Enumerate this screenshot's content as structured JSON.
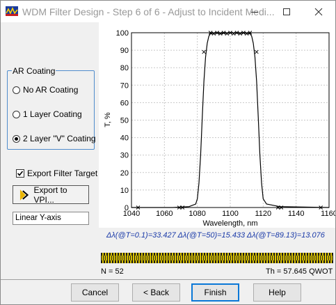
{
  "window": {
    "title": "WDM Filter Design - Step 6 of 6 - Adjust to Incident Medi..."
  },
  "ar_coating": {
    "legend": "AR Coating",
    "options": [
      {
        "label": "No AR Coating",
        "checked": false
      },
      {
        "label": "1 Layer Coating",
        "checked": false
      },
      {
        "label": "2 Layer \"V\" Coating",
        "checked": true
      }
    ]
  },
  "export_target": {
    "label": "Export Filter Target",
    "checked": true
  },
  "export_button": {
    "label": "Export to VPI..."
  },
  "yaxis_mode": {
    "value": "Linear Y-axis"
  },
  "chart_data": {
    "type": "line",
    "xlabel": "Wavelength, nm",
    "ylabel": "T, %",
    "xlim": [
      1040,
      1160
    ],
    "ylim": [
      0,
      100
    ],
    "xticks": [
      1040,
      1060,
      1080,
      1100,
      1120,
      1140,
      1160
    ],
    "yticks": [
      0,
      10,
      20,
      30,
      40,
      50,
      60,
      70,
      80,
      90,
      100
    ],
    "grid": true,
    "series": [
      {
        "x": [
          1040,
          1065,
          1075,
          1079,
          1080,
          1081,
          1082,
          1083,
          1084,
          1085,
          1086,
          1087,
          1088,
          1090,
          1095,
          1100,
          1105,
          1110,
          1112,
          1113,
          1114,
          1115,
          1116,
          1117,
          1118,
          1119,
          1120,
          1122,
          1130,
          1160
        ],
        "values": [
          0,
          0,
          0.5,
          2,
          5,
          14,
          30,
          52,
          72,
          86,
          94,
          98,
          99.5,
          99.8,
          99.6,
          99.9,
          99.7,
          99.8,
          99.5,
          98,
          94,
          86,
          72,
          52,
          30,
          14,
          5,
          2,
          0.5,
          0
        ]
      }
    ],
    "target_markers": {
      "x": [
        1044,
        1069,
        1071,
        1084,
        1088,
        1090,
        1092,
        1094,
        1096,
        1098,
        1100,
        1102,
        1104,
        1106,
        1108,
        1110,
        1112,
        1116,
        1129,
        1131,
        1155
      ],
      "values": [
        0,
        0,
        0,
        89,
        100,
        99.5,
        100,
        99.5,
        100,
        99.5,
        100,
        99.5,
        100,
        99.5,
        100,
        99.5,
        100,
        89,
        0,
        0,
        0
      ]
    }
  },
  "bandwidth_text": "Δλ(@T=0.1)=33.427  Δλ(@T=50)=15.433  Δλ(@T=89.13)=13.076",
  "n_label": "N = 52",
  "th_label": "Th = 57.645 QWOT",
  "buttons": {
    "cancel": "Cancel",
    "back": "< Back",
    "finish": "Finish",
    "help": "Help"
  }
}
